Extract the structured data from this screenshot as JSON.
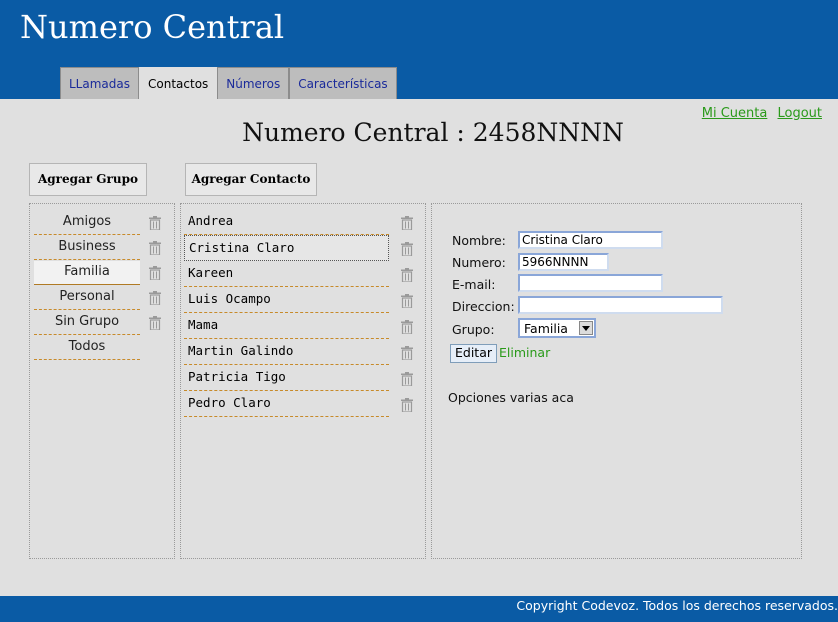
{
  "header": {
    "title": "Numero Central",
    "tabs": [
      {
        "label": "LLamadas",
        "active": false
      },
      {
        "label": "Contactos",
        "active": true
      },
      {
        "label": "Números",
        "active": false
      },
      {
        "label": "Características",
        "active": false
      }
    ]
  },
  "account": {
    "my_account": "Mi Cuenta",
    "logout": "Logout"
  },
  "main": {
    "heading": "Numero Central : 2458NNNN",
    "add_group_label": "Agregar Grupo",
    "add_contact_label": "Agregar Contacto"
  },
  "groups": {
    "items": [
      {
        "label": "Amigos",
        "deletable": true
      },
      {
        "label": "Business",
        "deletable": true
      },
      {
        "label": "Familia",
        "deletable": true,
        "selected": true
      },
      {
        "label": "Personal",
        "deletable": true
      },
      {
        "label": "Sin Grupo",
        "deletable": true
      },
      {
        "label": "Todos",
        "deletable": false
      }
    ]
  },
  "contacts": {
    "items": [
      {
        "name": "Andrea"
      },
      {
        "name": "Cristina Claro",
        "selected": true
      },
      {
        "name": "Kareen"
      },
      {
        "name": "Luis Ocampo"
      },
      {
        "name": "Mama"
      },
      {
        "name": "Martin Galindo"
      },
      {
        "name": "Patricia Tigo"
      },
      {
        "name": "Pedro Claro"
      }
    ]
  },
  "details": {
    "name_label": "Nombre:",
    "name_value": "Cristina Claro",
    "number_label": "Numero:",
    "number_value": "5966NNNN",
    "email_label": "E-mail:",
    "email_value": "",
    "address_label": "Direccion:",
    "address_value": "",
    "group_label": "Grupo:",
    "group_value": "Familia",
    "edit_label": "Editar",
    "delete_label": "Eliminar",
    "options_text": "Opciones varias aca"
  },
  "footer": {
    "copyright": "Copyright Codevoz. Todos los derechos reservados."
  },
  "colors": {
    "header_blue": "#0a5ba5",
    "link_green": "#2a9a1a",
    "tab_link": "#1a2a9a",
    "divider_orange": "#c78a2a"
  },
  "icons": {
    "delete": "trash-icon",
    "dropdown": "chevron-down-icon"
  }
}
